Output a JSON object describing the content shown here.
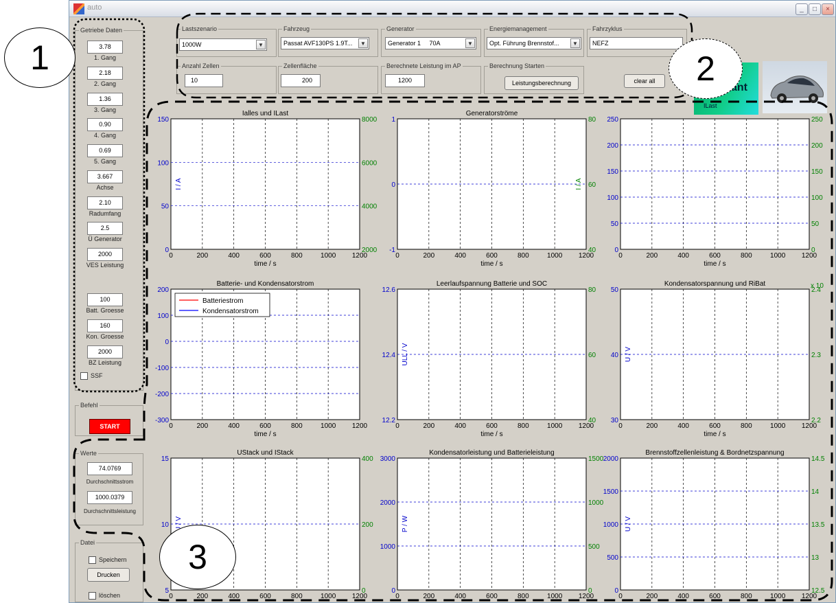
{
  "window": {
    "title": "auto"
  },
  "getriebe": {
    "legend": "Getriebe Daten",
    "items": [
      {
        "value": "3.78",
        "label": "1. Gang"
      },
      {
        "value": "2.18",
        "label": "2. Gang"
      },
      {
        "value": "1.36",
        "label": "3. Gang"
      },
      {
        "value": "0.90",
        "label": "4. Gang"
      },
      {
        "value": "0.69",
        "label": "5. Gang"
      },
      {
        "value": "3.667",
        "label": "Achse"
      },
      {
        "value": "2.10",
        "label": "Radumfang"
      },
      {
        "value": "2.5",
        "label": "Ü Generator"
      },
      {
        "value": "2000",
        "label": "VES Leistung"
      },
      {
        "value": "100",
        "label": "Batt. Groesse"
      },
      {
        "value": "160",
        "label": "Kon. Groesse"
      },
      {
        "value": "2000",
        "label": "BZ Leistung"
      }
    ],
    "ssf_label": "SSF"
  },
  "befehl": {
    "legend": "Befehl",
    "start_label": "START"
  },
  "werte": {
    "legend": "Werte",
    "strom_value": "74.0769",
    "strom_label": "Durchschnittsstrom",
    "leistung_value": "1000.0379",
    "leistung_label": "Durchschnittsleistung"
  },
  "datei": {
    "legend": "Datei",
    "speichern_label": "Speichern",
    "drucken_label": "Drucken",
    "loeschen_label": "löschen"
  },
  "top": {
    "lastszenario": {
      "legend": "Lastszenario",
      "value": "1000W"
    },
    "fahrzeug": {
      "legend": "Fahrzeug",
      "value": "Passat AVF130PS 1.9T..."
    },
    "generator": {
      "legend": "Generator",
      "value": "Generator 1     70A"
    },
    "energiemanagement": {
      "legend": "Energiemanagement",
      "value": "Opt. Führung Brennstof..."
    },
    "fahrzyklus": {
      "legend": "Fahrzyklus",
      "value": "NEFZ"
    },
    "anzahl_zellen": {
      "legend": "Anzahl Zellen",
      "value": "10"
    },
    "zellenflaeche": {
      "legend": "Zellenfläche",
      "value": "200"
    },
    "berechnete_leistung": {
      "legend": "Berechnete Leistung im AP",
      "value": "1200"
    },
    "berechnung": {
      "legend": "Berechnung Starten",
      "button": "Leistungsberechnung"
    },
    "clear_label": "clear all"
  },
  "logo": {
    "text": "ant",
    "sublabel": "ILast"
  },
  "annotations": [
    "1",
    "2",
    "3"
  ],
  "colors": {
    "blue": "#0000ff",
    "green": "#008000",
    "red": "#ff0000",
    "grid": "#0000cc",
    "window_bg": "#d4d0c8",
    "start_bg": "#ff0000"
  },
  "chart_data": [
    {
      "title": "Ialles und ILast",
      "type": "line",
      "xlabel": "time / s",
      "xlim": [
        0,
        1200
      ],
      "xticks": [
        0,
        200,
        400,
        600,
        800,
        1000,
        1200
      ],
      "ylim_left": [
        0,
        150
      ],
      "yticks_left": [
        0,
        50,
        100,
        150
      ],
      "ylabel_left": "I / A",
      "ylim_right": [
        2000,
        8000
      ],
      "yticks_right": [
        2000,
        4000,
        6000,
        8000
      ],
      "series": []
    },
    {
      "title": "Generatorströme",
      "type": "line",
      "xlabel": "time / s",
      "xlim": [
        0,
        1200
      ],
      "xticks": [
        0,
        200,
        400,
        600,
        800,
        1000,
        1200
      ],
      "ylim_left": [
        -1,
        1
      ],
      "yticks_left": [
        -1,
        0,
        1
      ],
      "ylabel_left": "",
      "ylim_right": [
        40,
        80
      ],
      "yticks_right": [
        40,
        60,
        80
      ],
      "ylabel_right": "I / A",
      "series": []
    },
    {
      "title": "",
      "type": "line",
      "xlabel": "time / s",
      "xlim": [
        0,
        1200
      ],
      "xticks": [
        0,
        200,
        400,
        600,
        800,
        1000,
        1200
      ],
      "ylim_left": [
        0,
        250
      ],
      "yticks_left": [
        0,
        50,
        100,
        150,
        200,
        250
      ],
      "ylim_right": [
        0,
        250
      ],
      "yticks_right": [
        0,
        50,
        100,
        150,
        200,
        250
      ],
      "series": []
    },
    {
      "title": "Batterie- und Kondensatorstrom",
      "type": "line",
      "xlabel": "time  / s",
      "xlim": [
        0,
        1200
      ],
      "xticks": [
        0,
        200,
        400,
        600,
        800,
        1000,
        1200
      ],
      "ylim_left": [
        -300,
        200
      ],
      "yticks_left": [
        -300,
        -200,
        -100,
        0,
        100,
        200
      ],
      "legend": [
        "Batteriestrom",
        "Kondensatorstrom"
      ],
      "series": []
    },
    {
      "title": "Leerlaufspannung Batterie und SOC",
      "type": "line",
      "xlabel": "time / s",
      "xlim": [
        0,
        1200
      ],
      "xticks": [
        0,
        200,
        400,
        600,
        800,
        1000,
        1200
      ],
      "ylim_left": [
        12.2,
        12.6
      ],
      "yticks_left": [
        12.2,
        12.4,
        12.6
      ],
      "ylabel_left": "ULL / V",
      "ylim_right": [
        40,
        80
      ],
      "yticks_right": [
        40,
        60,
        80
      ],
      "series": []
    },
    {
      "title": "Kondensatorspannung und RiBat",
      "type": "line",
      "xlabel": "time / s",
      "xlim": [
        0,
        1200
      ],
      "xticks": [
        0,
        200,
        400,
        600,
        800,
        1000,
        1200
      ],
      "ylim_left": [
        30,
        50
      ],
      "yticks_left": [
        30,
        40,
        50
      ],
      "ylabel_left": "U / V",
      "ylim_right": [
        2.2,
        2.4
      ],
      "yticks_right": [
        2.2,
        2.3,
        2.4
      ],
      "right_exponent": "x 10",
      "series": []
    },
    {
      "title": "UStack und IStack",
      "type": "line",
      "xlabel": "",
      "xlim": [
        0,
        1200
      ],
      "xticks": [
        0,
        200,
        400,
        600,
        800,
        1000,
        1200
      ],
      "ylim_left": [
        5,
        15
      ],
      "yticks_left": [
        5,
        10,
        15
      ],
      "ylabel_left": "U / V",
      "ylim_right": [
        0,
        400
      ],
      "yticks_right": [
        0,
        200,
        400
      ],
      "series": []
    },
    {
      "title": "Kondensatorleistung und Batterieleistung",
      "type": "line",
      "xlabel": "",
      "xlim": [
        0,
        1200
      ],
      "xticks": [
        0,
        200,
        400,
        600,
        800,
        1000,
        1200
      ],
      "ylim_left": [
        0,
        3000
      ],
      "yticks_left": [
        0,
        1000,
        2000,
        3000
      ],
      "ylabel_left": "P / W",
      "ylim_right": [
        0,
        1500
      ],
      "yticks_right": [
        0,
        500,
        1000,
        1500
      ],
      "series": []
    },
    {
      "title": "Brennstoffzellenleistung & Bordnetzspannung",
      "type": "line",
      "xlabel": "",
      "xlim": [
        0,
        1200
      ],
      "xticks": [
        0,
        200,
        400,
        600,
        800,
        1000,
        1200
      ],
      "ylim_left": [
        0,
        2000
      ],
      "yticks_left": [
        0,
        500,
        1000,
        1500,
        2000
      ],
      "ylabel_left": "U / V",
      "ylim_right": [
        12.5,
        14.5
      ],
      "yticks_right": [
        12.5,
        13,
        13.5,
        14,
        14.5
      ],
      "series": []
    }
  ]
}
